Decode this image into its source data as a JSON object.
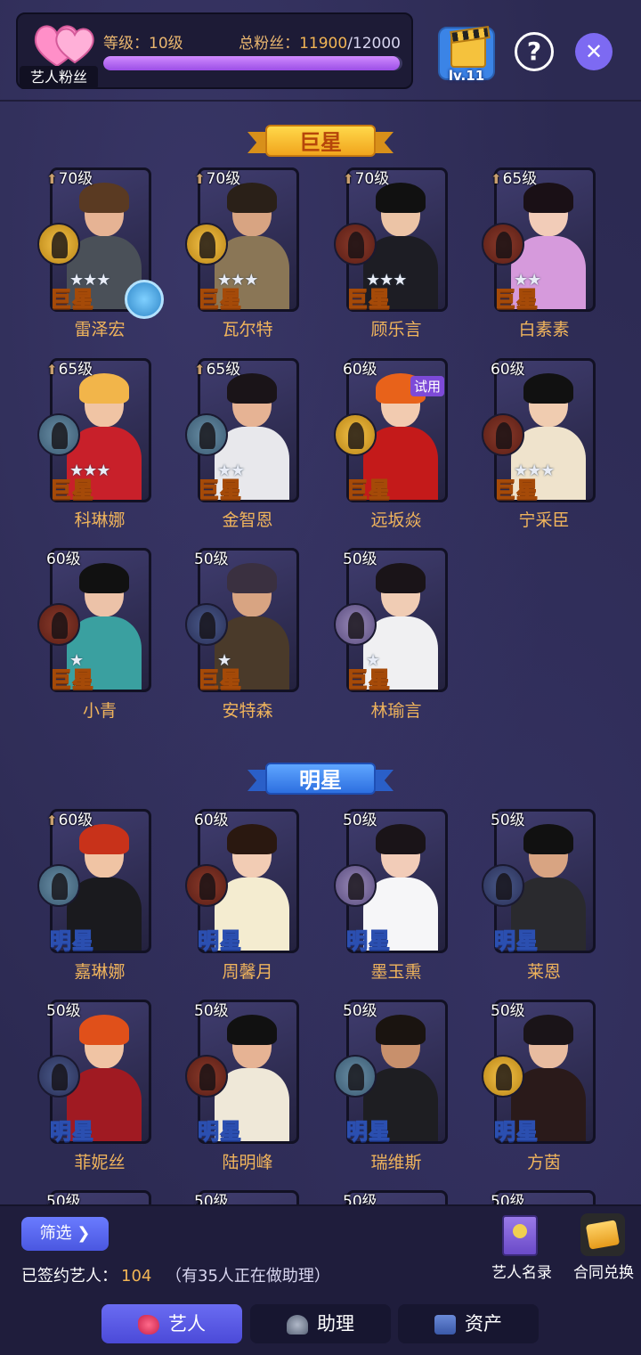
{
  "header": {
    "fans_badge": "艺人粉丝",
    "level_label": "等级：",
    "level_value": "10级",
    "fans_label": "总粉丝：",
    "fans_current": "11900",
    "fans_max": "/12000",
    "fans_progress_fraction": 0.9917,
    "lv_label": "lv.11",
    "help_label": "?",
    "close_label": "✕"
  },
  "sections": {
    "superstar": "巨星",
    "star": "明星"
  },
  "superstars": [
    {
      "level": "70级",
      "up": true,
      "name": "雷泽宏",
      "stars": "★★★",
      "tier": "巨星",
      "role": "gold-icon",
      "extra": true
    },
    {
      "level": "70级",
      "up": true,
      "name": "瓦尔特",
      "stars": "★★★",
      "tier": "巨星",
      "role": "gold-icon"
    },
    {
      "level": "70级",
      "up": true,
      "name": "顾乐言",
      "stars": "★★★",
      "tier": "巨星",
      "role": "red-icon"
    },
    {
      "level": "65级",
      "up": true,
      "name": "白素素",
      "stars": "★★",
      "tier": "巨星",
      "role": "red-icon"
    },
    {
      "level": "65级",
      "up": true,
      "name": "科琳娜",
      "stars": "★★★",
      "tier": "巨星",
      "role": "teal-icon"
    },
    {
      "level": "65级",
      "up": true,
      "name": "金智恩",
      "stars": "★★",
      "tier": "巨星",
      "role": "teal-icon"
    },
    {
      "level": "60级",
      "up": false,
      "name": "远坂焱",
      "stars": "",
      "tier": "巨星",
      "role": "gold-icon",
      "trial": "试用"
    },
    {
      "level": "60级",
      "up": false,
      "name": "宁采臣",
      "stars": "★★★",
      "tier": "巨星",
      "role": "red-icon"
    },
    {
      "level": "60级",
      "up": false,
      "name": "小青",
      "stars": "★",
      "tier": "巨星",
      "role": "red-icon"
    },
    {
      "level": "50级",
      "up": false,
      "name": "安特森",
      "stars": "★",
      "tier": "巨星",
      "role": "navy-icon"
    },
    {
      "level": "50级",
      "up": false,
      "name": "林瑜言",
      "stars": "★",
      "tier": "巨星",
      "role": "purple-icon"
    }
  ],
  "stars_list": [
    {
      "level": "60级",
      "up": true,
      "name": "嘉琳娜",
      "tier": "明星",
      "role": "teal-icon"
    },
    {
      "level": "60级",
      "up": false,
      "name": "周馨月",
      "tier": "明星",
      "role": "red-icon"
    },
    {
      "level": "50级",
      "up": false,
      "name": "墨玉熏",
      "tier": "明星",
      "role": "purple-icon"
    },
    {
      "level": "50级",
      "up": false,
      "name": "莱恩",
      "tier": "明星",
      "role": "navy-icon"
    },
    {
      "level": "50级",
      "up": false,
      "name": "菲妮丝",
      "tier": "明星",
      "role": "navy-icon"
    },
    {
      "level": "50级",
      "up": false,
      "name": "陆明峰",
      "tier": "明星",
      "role": "red-icon"
    },
    {
      "level": "50级",
      "up": false,
      "name": "瑞维斯",
      "tier": "明星",
      "role": "teal-icon"
    },
    {
      "level": "50级",
      "up": false,
      "name": "方茵",
      "tier": "明星",
      "role": "gold-icon"
    },
    {
      "level": "50级",
      "up": false,
      "name": "",
      "tier": "",
      "role": ""
    },
    {
      "level": "50级",
      "up": false,
      "name": "",
      "tier": "",
      "role": ""
    },
    {
      "level": "50级",
      "up": false,
      "name": "",
      "tier": "",
      "role": ""
    },
    {
      "level": "50级",
      "up": false,
      "name": "",
      "tier": "",
      "role": ""
    }
  ],
  "bottom": {
    "filter_label": "筛选 ❯",
    "signed_label": "已签约艺人：",
    "signed_count": "104",
    "signed_note": "（有35人正在做助理）",
    "roster_label": "艺人名录",
    "contract_label": "合同兑换"
  },
  "tabs": [
    {
      "label": "艺人",
      "icon": "artist-icon",
      "active": true
    },
    {
      "label": "助理",
      "icon": "assistant-icon",
      "active": false
    },
    {
      "label": "资产",
      "icon": "asset-icon",
      "active": false
    }
  ],
  "colors": {
    "background": "#2c2a52",
    "accent_gold": "#f0b45c",
    "progress": "#b46cf0",
    "tab_active": "#5a5be4"
  }
}
